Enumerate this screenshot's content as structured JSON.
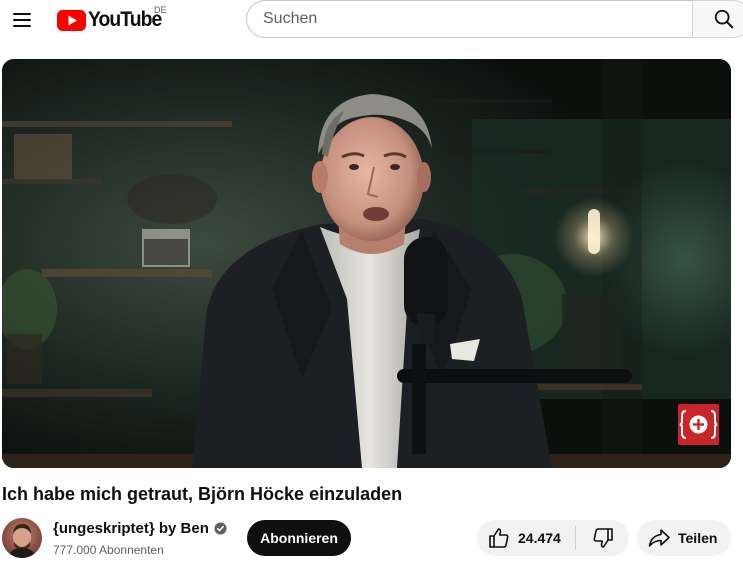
{
  "header": {
    "logo_text": "YouTube",
    "region_code": "DE",
    "search_placeholder": "Suchen",
    "search_value": ""
  },
  "video": {
    "title": "Ich habe mich getraut, Björn Höcke einzuladen",
    "channel": {
      "name": "{ungeskriptet} by Ben",
      "verified": true,
      "subscribers": "777.000 Abonnenten"
    },
    "subscribe_label": "Abonnieren",
    "like_count": "24.474",
    "share_label": "Teilen"
  },
  "icons": {
    "menu": "hamburger-menu-icon",
    "logo": "youtube-logo-icon",
    "search": "search-icon",
    "verified": "verified-check-icon",
    "like": "thumbs-up-icon",
    "dislike": "thumbs-down-icon",
    "share": "share-arrow-icon",
    "channel_watermark": "channel-watermark-icon"
  },
  "colors": {
    "brand_red": "#ff0000",
    "text_primary": "#0f0f0f",
    "text_secondary": "#606060",
    "button_dark": "#0f0f0f",
    "pill_bg": "#f2f2f2",
    "watermark_red": "#c8262b"
  }
}
